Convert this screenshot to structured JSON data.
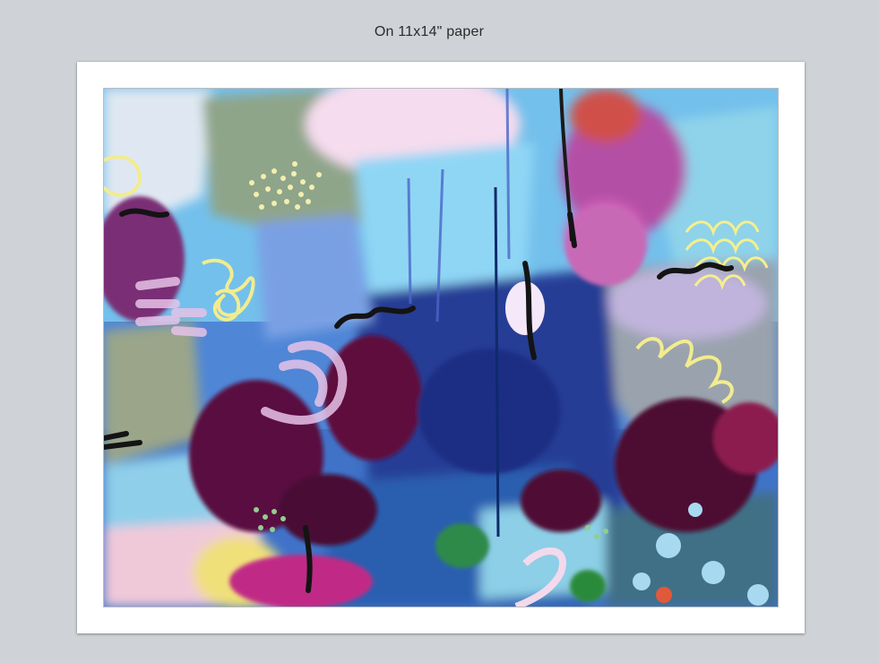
{
  "caption": "On 11x14\" paper",
  "artwork": {
    "palette": {
      "deep_purple": "#5a1037",
      "navy": "#1f3d8a",
      "sky_blue": "#7fd0f0",
      "lavender": "#b39ae0",
      "pink": "#f2c9e8",
      "yellow": "#f0ea8a",
      "magenta": "#b23a8d",
      "grey": "#9aa0a8"
    }
  }
}
